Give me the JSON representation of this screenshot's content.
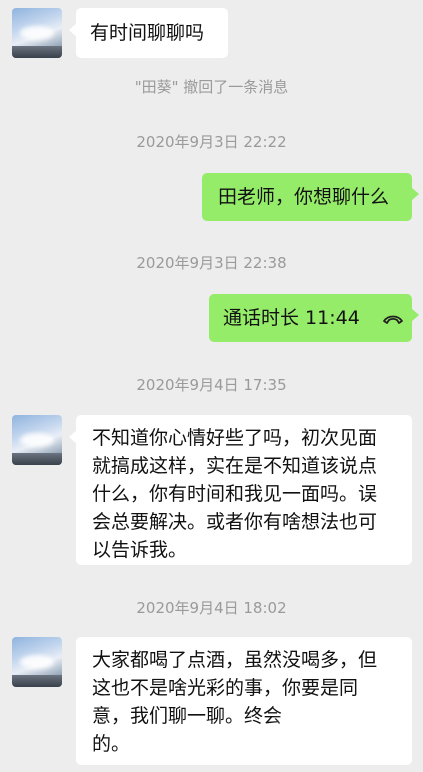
{
  "messages": [
    {
      "type": "text",
      "side": "left",
      "text": "有时间聊聊吗"
    },
    {
      "type": "system",
      "text": "\"田葵\" 撤回了一条消息"
    },
    {
      "type": "timestamp",
      "text": "2020年9月3日 22:22"
    },
    {
      "type": "text",
      "side": "right",
      "text": "田老师，你想聊什么"
    },
    {
      "type": "timestamp",
      "text": "2020年9月3日 22:38"
    },
    {
      "type": "call",
      "side": "right",
      "text": "通话时长 11:44",
      "icon": "phone-hangup-icon"
    },
    {
      "type": "timestamp",
      "text": "2020年9月4日 17:35"
    },
    {
      "type": "text",
      "side": "left",
      "lines": [
        "不知道你心情好些了吗，初次见面",
        "就搞成这样，实在是不知道该说点",
        "什么，你有时间和我见一面吗。误",
        "会总要解决。或者你有啥想法也可",
        "以告诉我。"
      ]
    },
    {
      "type": "timestamp",
      "text": "2020年9月4日 18:02"
    },
    {
      "type": "text",
      "side": "left",
      "lines": [
        "大家都喝了点酒，虽然没喝多，但",
        "这也不是啥光彩的事，你要是同",
        "意，我们聊一聊。终会",
        "的。"
      ]
    }
  ],
  "colors": {
    "background": "#ededed",
    "bubble_left": "#ffffff",
    "bubble_right": "#95ec69",
    "meta_text": "#9a9a9a"
  }
}
